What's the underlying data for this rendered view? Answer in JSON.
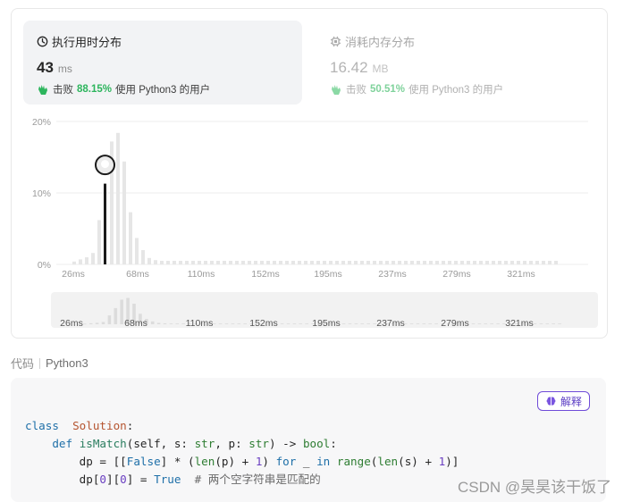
{
  "runtime": {
    "title": "执行用时分布",
    "value": "43",
    "unit": "ms",
    "beats_prefix": "击败",
    "beats_pct": "88.15%",
    "beats_suffix": "使用 Python3 的用户"
  },
  "memory": {
    "title": "消耗内存分布",
    "value": "16.42",
    "unit": "MB",
    "beats_prefix": "击败",
    "beats_pct": "50.51%",
    "beats_suffix": "使用 Python3 的用户"
  },
  "chart_data": {
    "type": "bar",
    "title": "",
    "xlabel": "",
    "ylabel": "",
    "y_ticks": [
      "20%",
      "10%",
      "0%"
    ],
    "x_tick_labels": [
      "26ms",
      "68ms",
      "110ms",
      "152ms",
      "195ms",
      "237ms",
      "279ms",
      "321ms"
    ],
    "ylim": [
      0,
      20
    ],
    "x_range_ms": [
      22,
      349
    ],
    "bin_width_ms": 4.2,
    "highlighted_runtime_ms": 43,
    "highlighted_value": 11.3,
    "values": [
      0.4,
      0.7,
      1.0,
      1.6,
      6.2,
      11.3,
      17.2,
      18.4,
      14.4,
      7.3,
      3.7,
      2.0,
      0.9,
      0.6,
      0.5,
      0.5,
      0.5,
      0.5,
      0.5,
      0.5,
      0.5,
      0.5,
      0.5,
      0.5,
      0.5,
      0.5,
      0.5,
      0.5,
      0.5,
      0.5,
      0.5,
      0.5,
      0.5,
      0.5,
      0.5,
      0.5,
      0.5,
      0.5,
      0.5,
      0.5,
      0.5,
      0.5,
      0.5,
      0.5,
      0.5,
      0.5,
      0.5,
      0.5,
      0.5,
      0.5,
      0.5,
      0.5,
      0.5,
      0.5,
      0.5,
      0.5,
      0.5,
      0.5,
      0.5,
      0.5,
      0.5,
      0.5,
      0.5,
      0.5,
      0.5,
      0.5,
      0.5,
      0.5,
      0.5,
      0.5,
      0.5,
      0.5,
      0.5,
      0.5,
      0.5,
      0.5,
      0.5,
      0.5
    ],
    "grid": true,
    "colors": {
      "bar": "#e6e6e6",
      "highlight": "#1a1a1a",
      "grid": "#ececec",
      "navigator_bg": "#f2f2f2"
    }
  },
  "code_section": {
    "label": "代码",
    "language": "Python3",
    "explain_label": "解释",
    "lines": [
      [
        [
          "kw",
          "class"
        ],
        [
          "",
          "  "
        ],
        [
          "cls",
          "Solution"
        ],
        [
          "",
          ":"
        ]
      ],
      [
        [
          "",
          "    "
        ],
        [
          "kw",
          "def"
        ],
        [
          "",
          " "
        ],
        [
          "fn",
          "isMatch"
        ],
        [
          "",
          "(self, s: "
        ],
        [
          "bi",
          "str"
        ],
        [
          "",
          ", p: "
        ],
        [
          "bi",
          "str"
        ],
        [
          "",
          ") -> "
        ],
        [
          "bi",
          "bool"
        ],
        [
          "",
          ":"
        ]
      ],
      [
        [
          "",
          "        dp = [["
        ],
        [
          "kw",
          "False"
        ],
        [
          "",
          "] * ("
        ],
        [
          "bi",
          "len"
        ],
        [
          "",
          "(p) + "
        ],
        [
          "num",
          "1"
        ],
        [
          "",
          ") "
        ],
        [
          "kw",
          "for"
        ],
        [
          "",
          " _ "
        ],
        [
          "kw",
          "in"
        ],
        [
          "",
          " "
        ],
        [
          "bi",
          "range"
        ],
        [
          "",
          "("
        ],
        [
          "bi",
          "len"
        ],
        [
          "",
          "(s) + "
        ],
        [
          "num",
          "1"
        ],
        [
          "",
          ")]"
        ]
      ],
      [
        [
          "",
          "        dp["
        ],
        [
          "num",
          "0"
        ],
        [
          "",
          "]["
        ],
        [
          "num",
          "0"
        ],
        [
          "",
          "] = "
        ],
        [
          "kw",
          "True"
        ],
        [
          "",
          "  "
        ],
        [
          "cmt",
          "# 两个空字符串是匹配的"
        ]
      ]
    ]
  },
  "watermark": "CSDN @昊昊该干饭了"
}
